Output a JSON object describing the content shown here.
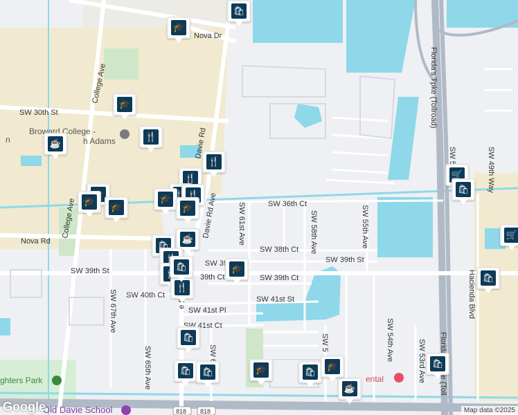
{
  "map": {
    "street_labels": [
      {
        "id": "nova-dr",
        "text": "Nova Dr"
      },
      {
        "id": "sw-30th-st",
        "text": "SW 30th St"
      },
      {
        "id": "college-ave-n",
        "text": "College Ave"
      },
      {
        "id": "college-ave-s",
        "text": "College Ave"
      },
      {
        "id": "sw-36th-ct",
        "text": "SW 36th Ct"
      },
      {
        "id": "nova-rd",
        "text": "Nova Rd"
      },
      {
        "id": "sw-38th-ct",
        "text": "SW 38th Ct"
      },
      {
        "id": "sw-39th-st-w",
        "text": "SW 39th St"
      },
      {
        "id": "sw-39th-st-mid",
        "text": "SW 39"
      },
      {
        "id": "sw-39th-st-e",
        "text": "SW 39th St"
      },
      {
        "id": "sw-39th-ct-w",
        "text": "39th Ct"
      },
      {
        "id": "sw-39th-ct",
        "text": "SW 39th Ct"
      },
      {
        "id": "sw-40th-ct",
        "text": "SW 40th Ct"
      },
      {
        "id": "sw-41st-st",
        "text": "SW 41st St"
      },
      {
        "id": "sw-41st-pl",
        "text": "SW 41st Pl"
      },
      {
        "id": "sw-41st-ct",
        "text": "SW 41st Ct"
      },
      {
        "id": "sw-61st-ave",
        "text": "SW 61st Ave"
      },
      {
        "id": "sw-58th-ave",
        "text": "SW 58th Ave"
      },
      {
        "id": "sw-55th-ave",
        "text": "SW 55th Ave"
      },
      {
        "id": "sw-54th-ave",
        "text": "SW 54th Ave"
      },
      {
        "id": "sw-53rd-ave",
        "text": "SW 53rd Ave"
      },
      {
        "id": "sw-49th-way",
        "text": "SW 49th Way"
      },
      {
        "id": "sw-5x-ave",
        "text": "SW 5"
      },
      {
        "id": "sw-67th-ave",
        "text": "SW 67th Ave"
      },
      {
        "id": "sw-65th-ave",
        "text": "SW 65th Ave"
      },
      {
        "id": "sw-6x-ave",
        "text": "SW 6"
      },
      {
        "id": "sw-5x-ave-s",
        "text": "SW 5"
      },
      {
        "id": "hacienda-blvd",
        "text": "Hacienda Blvd"
      },
      {
        "id": "florida-tpke-n",
        "text": "Florida's Tpke (Tollroad)"
      },
      {
        "id": "florida-tpke-s",
        "text": "Florida's Tpke (Toll"
      },
      {
        "id": "davie-rd-n",
        "text": "Davie Rd"
      },
      {
        "id": "davie-rd-mid",
        "text": "Davie Rd Ave"
      },
      {
        "id": "davie-rd-s",
        "text": "e Rd"
      }
    ],
    "place_labels": [
      {
        "id": "broward-college",
        "text": "Broward College -"
      },
      {
        "id": "broward-college-2",
        "text": "h Adams"
      },
      {
        "id": "broward-college-3",
        "text": "n"
      },
      {
        "id": "old-davie-school",
        "text": "Old Davie School"
      },
      {
        "id": "fighters-park",
        "text": "ghters Park"
      },
      {
        "id": "dental",
        "text": "ental"
      }
    ],
    "route_shields": [
      "818",
      "818"
    ],
    "pins": [
      {
        "kind": "shopping",
        "icon": "shopping-bag-icon"
      },
      {
        "kind": "school",
        "icon": "graduation-cap-icon"
      },
      {
        "kind": "school",
        "icon": "graduation-cap-icon"
      },
      {
        "kind": "restaurant",
        "icon": "fork-knife-icon"
      },
      {
        "kind": "cafe",
        "icon": "coffee-cup-icon"
      },
      {
        "kind": "restaurant",
        "icon": "fork-knife-icon"
      },
      {
        "kind": "restaurant",
        "icon": "fork-knife-icon"
      },
      {
        "kind": "school",
        "icon": "graduation-cap-icon"
      },
      {
        "kind": "school",
        "icon": "graduation-cap-icon"
      },
      {
        "kind": "school",
        "icon": "graduation-cap-icon"
      },
      {
        "kind": "restaurant",
        "icon": "fork-knife-icon"
      },
      {
        "kind": "restaurant",
        "icon": "fork-knife-icon"
      },
      {
        "kind": "school",
        "icon": "graduation-cap-icon"
      },
      {
        "kind": "shopping",
        "icon": "shopping-bag-icon"
      },
      {
        "kind": "cafe",
        "icon": "coffee-cup-icon"
      },
      {
        "kind": "restaurant",
        "icon": "fork-knife-icon"
      },
      {
        "kind": "school",
        "icon": "graduation-cap-icon"
      },
      {
        "kind": "restaurant",
        "icon": "fork-knife-icon"
      },
      {
        "kind": "restaurant",
        "icon": "fork-knife-icon"
      },
      {
        "kind": "shopping",
        "icon": "shopping-bag-icon"
      },
      {
        "kind": "shopping",
        "icon": "shopping-bag-icon"
      },
      {
        "kind": "shopping",
        "icon": "shopping-bag-icon"
      },
      {
        "kind": "school",
        "icon": "graduation-cap-icon"
      },
      {
        "kind": "shopping",
        "icon": "shopping-bag-icon"
      },
      {
        "kind": "school",
        "icon": "graduation-cap-icon"
      },
      {
        "kind": "cafe",
        "icon": "coffee-cup-icon"
      },
      {
        "kind": "shopping",
        "icon": "shopping-bag-icon"
      },
      {
        "kind": "shopping-cart",
        "icon": "shopping-cart-icon"
      },
      {
        "kind": "shopping",
        "icon": "shopping-bag-icon"
      },
      {
        "kind": "shopping-cart",
        "icon": "shopping-cart-icon"
      },
      {
        "kind": "shopping",
        "icon": "shopping-bag-icon"
      }
    ]
  },
  "attribution": {
    "logo": "Google",
    "data": "Map data ©2025"
  },
  "colors": {
    "water": "#8ed8ea",
    "park": "#d6eed6",
    "campus": "#f1ead0",
    "road": "#ffffff",
    "highway": "#b0bac6",
    "pin_icon": "#0d3a57"
  }
}
